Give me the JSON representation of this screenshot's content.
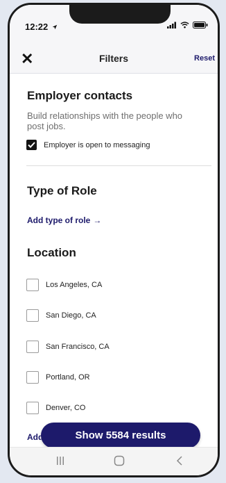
{
  "status_bar": {
    "time": "12:22",
    "location_icon": "location-arrow-icon",
    "signal_icon": "cellular-signal-icon",
    "wifi_icon": "wifi-icon",
    "battery_icon": "battery-icon"
  },
  "header": {
    "close_icon": "close-icon",
    "title": "Filters",
    "reset_label": "Reset"
  },
  "employer_contacts": {
    "title": "Employer contacts",
    "description": "Build relationships with the people who post jobs.",
    "option": {
      "label": "Employer is open to messaging",
      "checked": true
    }
  },
  "type_of_role": {
    "title": "Type of Role",
    "add_label": "Add type of role",
    "arrow": "→"
  },
  "location": {
    "title": "Location",
    "options": [
      {
        "label": "Los Angeles, CA",
        "checked": false
      },
      {
        "label": "San Diego, CA",
        "checked": false
      },
      {
        "label": "San Francisco, CA",
        "checked": false
      },
      {
        "label": "Portland, OR",
        "checked": false
      },
      {
        "label": "Denver, CO",
        "checked": false
      }
    ],
    "add_label_partial": "Add"
  },
  "show_results": {
    "label": "Show 5584 results"
  },
  "colors": {
    "accent": "#1d1a6b",
    "background": "#e3e8f1",
    "checkbox_checked": "#131313"
  }
}
